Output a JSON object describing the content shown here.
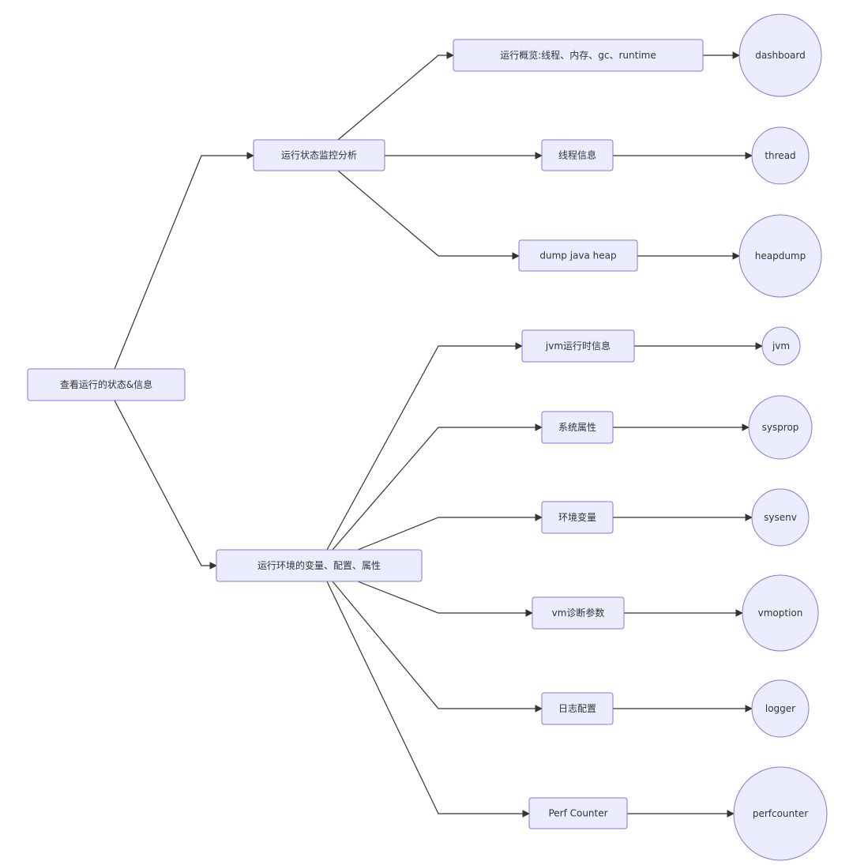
{
  "diagram": {
    "type": "flowchart",
    "direction": "left-to-right",
    "colors": {
      "node_fill": "#ECECFF",
      "node_stroke": "#9370DB",
      "edge": "#333333",
      "text": "#333333"
    },
    "nodes": [
      {
        "id": "root",
        "label": "查看运行的状态&信息",
        "shape": "rect"
      },
      {
        "id": "monitor",
        "label": "运行状态监控分析",
        "shape": "rect"
      },
      {
        "id": "env",
        "label": "运行环境的变量、配置、属性",
        "shape": "rect"
      },
      {
        "id": "overview",
        "label": "运行概览:线程、内存、gc、runtime",
        "shape": "rect"
      },
      {
        "id": "threadinfo",
        "label": "线程信息",
        "shape": "rect"
      },
      {
        "id": "dumpheap",
        "label": "dump java heap",
        "shape": "rect"
      },
      {
        "id": "jvminfo",
        "label": "jvm运行时信息",
        "shape": "rect"
      },
      {
        "id": "sysattr",
        "label": "系统属性",
        "shape": "rect"
      },
      {
        "id": "envvar",
        "label": "环境变量",
        "shape": "rect"
      },
      {
        "id": "vmdiag",
        "label": "vm诊断参数",
        "shape": "rect"
      },
      {
        "id": "logconf",
        "label": "日志配置",
        "shape": "rect"
      },
      {
        "id": "perf",
        "label": "Perf Counter",
        "shape": "rect"
      },
      {
        "id": "dashboard",
        "label": "dashboard",
        "shape": "circle"
      },
      {
        "id": "thread",
        "label": "thread",
        "shape": "circle"
      },
      {
        "id": "heapdump",
        "label": "heapdump",
        "shape": "circle"
      },
      {
        "id": "jvm",
        "label": "jvm",
        "shape": "circle"
      },
      {
        "id": "sysprop",
        "label": "sysprop",
        "shape": "circle"
      },
      {
        "id": "sysenv",
        "label": "sysenv",
        "shape": "circle"
      },
      {
        "id": "vmoption",
        "label": "vmoption",
        "shape": "circle"
      },
      {
        "id": "logger",
        "label": "logger",
        "shape": "circle"
      },
      {
        "id": "perfcounter",
        "label": "perfcounter",
        "shape": "circle"
      }
    ],
    "edges": [
      {
        "from": "root",
        "to": "monitor"
      },
      {
        "from": "root",
        "to": "env"
      },
      {
        "from": "monitor",
        "to": "overview"
      },
      {
        "from": "monitor",
        "to": "threadinfo"
      },
      {
        "from": "monitor",
        "to": "dumpheap"
      },
      {
        "from": "env",
        "to": "jvminfo"
      },
      {
        "from": "env",
        "to": "sysattr"
      },
      {
        "from": "env",
        "to": "envvar"
      },
      {
        "from": "env",
        "to": "vmdiag"
      },
      {
        "from": "env",
        "to": "logconf"
      },
      {
        "from": "env",
        "to": "perf"
      },
      {
        "from": "overview",
        "to": "dashboard"
      },
      {
        "from": "threadinfo",
        "to": "thread"
      },
      {
        "from": "dumpheap",
        "to": "heapdump"
      },
      {
        "from": "jvminfo",
        "to": "jvm"
      },
      {
        "from": "sysattr",
        "to": "sysprop"
      },
      {
        "from": "envvar",
        "to": "sysenv"
      },
      {
        "from": "vmdiag",
        "to": "vmoption"
      },
      {
        "from": "logconf",
        "to": "logger"
      },
      {
        "from": "perf",
        "to": "perfcounter"
      }
    ]
  }
}
